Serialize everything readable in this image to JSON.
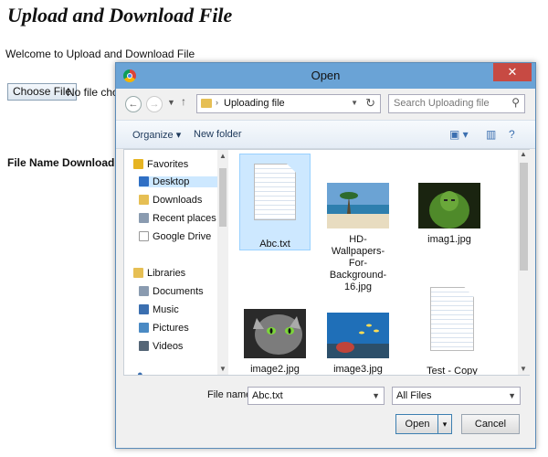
{
  "page": {
    "title": "Upload and Download File",
    "welcome": "Welcome to Upload and Download File",
    "choose_file_label": "Choose File",
    "no_file_text": "No file chose",
    "file_name_download": "File Name Download"
  },
  "dialog": {
    "title": "Open",
    "close_glyph": "✕",
    "address_path": "Uploading file",
    "search_placeholder": "Search Uploading file",
    "toolbar": {
      "organize": "Organize ▾",
      "new_folder": "New folder"
    },
    "nav_tree": [
      {
        "label": "Favorites",
        "icon": "star-icon",
        "color": "#e6b422"
      },
      {
        "label": "Desktop",
        "icon": "desktop-icon",
        "color": "#2f6fc4"
      },
      {
        "label": "Downloads",
        "icon": "downloads-icon",
        "color": "#e6bf54"
      },
      {
        "label": "Recent places",
        "icon": "recent-places-icon",
        "color": "#8a9bb0"
      },
      {
        "label": "Google Drive",
        "icon": "drive-icon",
        "color": "#ffffff"
      },
      {
        "label": "Libraries",
        "icon": "libraries-icon",
        "color": "#e6bf54"
      },
      {
        "label": "Documents",
        "icon": "documents-icon",
        "color": "#8a9bb0"
      },
      {
        "label": "Music",
        "icon": "music-icon",
        "color": "#3b6fb0"
      },
      {
        "label": "Pictures",
        "icon": "pictures-icon",
        "color": "#4a8ac4"
      },
      {
        "label": "Videos",
        "icon": "videos-icon",
        "color": "#556677"
      }
    ],
    "files": [
      {
        "name": "Abc.txt",
        "kind": "text"
      },
      {
        "name": "HD-Wallpapers-For-Background-16.jpg",
        "kind": "beach"
      },
      {
        "name": "imag1.jpg",
        "kind": "hulk"
      },
      {
        "name": "image2.jpg",
        "kind": "cat"
      },
      {
        "name": "image3.jpg",
        "kind": "sea"
      },
      {
        "name": "Test - Copy",
        "kind": "text"
      }
    ],
    "file_name_label": "File name:",
    "file_name_value": "Abc.txt",
    "file_type_value": "All Files",
    "open_label": "Open",
    "cancel_label": "Cancel",
    "accent": "#6aa3d6",
    "close_color": "#c74a43"
  }
}
